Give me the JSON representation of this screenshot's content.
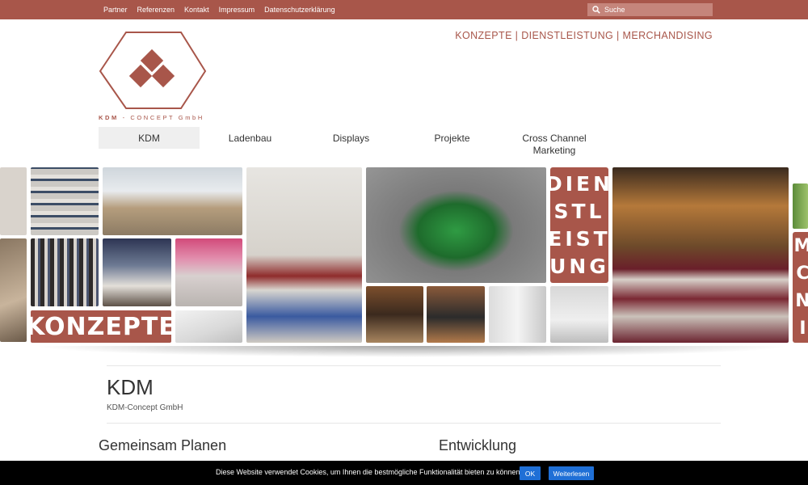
{
  "topbar": {
    "links": [
      "Partner",
      "Referenzen",
      "Kontakt",
      "Impressum",
      "Datenschutzerklärung"
    ],
    "search_placeholder": "Suche"
  },
  "header": {
    "tagline": "KONZEPTE | DIENSTLEISTUNG | MERCHANDISING",
    "logo_text_bold": "KDM",
    "logo_text_rest": "- CONCEPT GmbH"
  },
  "nav": {
    "items": [
      "KDM",
      "Ladenbau",
      "Displays",
      "Projekte",
      "Cross Channel Marketing"
    ],
    "active": "KDM"
  },
  "collage": {
    "word_konzepte": "KONZEPTE",
    "dienstleistung_lines": [
      "DIEN",
      "STL",
      "EIST",
      "UNG"
    ],
    "merch_letters": [
      "M",
      "C",
      "N",
      "I"
    ]
  },
  "content": {
    "title": "KDM",
    "subtitle": "KDM-Concept GmbH",
    "left_heading": "Gemeinsam Planen",
    "right_heading": "Entwicklung"
  },
  "cookie": {
    "text": "Diese Website verwendet Cookies, um Ihnen die bestmögliche Funktionalität bieten zu können.",
    "ok_label": "OK",
    "more_label": "Weiterlesen"
  },
  "colors": {
    "brand": "#a8564a",
    "button": "#1f6fd6"
  }
}
